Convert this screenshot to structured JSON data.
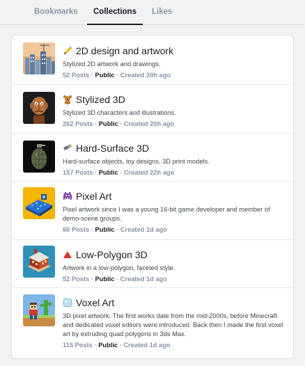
{
  "tabs": [
    {
      "label": "Bookmarks",
      "active": false
    },
    {
      "label": "Collections",
      "active": true
    },
    {
      "label": "Likes",
      "active": false
    }
  ],
  "collections": [
    {
      "icon": "pencil-icon",
      "title": "2D design and artwork",
      "description": "Stylized 2D artwork and drawings.",
      "posts": "52 Posts",
      "visibility": "Public",
      "created": "Created 20h ago"
    },
    {
      "icon": "teddy-bear-icon",
      "title": "Stylized 3D",
      "description": "Stylized 3D characters and illustrations.",
      "posts": "262 Posts",
      "visibility": "Public",
      "created": "Created 20h ago"
    },
    {
      "icon": "flashlight-icon",
      "title": "Hard-Surface 3D",
      "description": "Hard-surface objects, toy designs, 3D print models.",
      "posts": "157 Posts",
      "visibility": "Public",
      "created": "Created 22h ago"
    },
    {
      "icon": "space-invader-icon",
      "title": "Pixel Art",
      "description": "Pixel artwork since I was a young 16-bit game developer and member of demo-scene groups.",
      "posts": "60 Posts",
      "visibility": "Public",
      "created": "Created 1d ago"
    },
    {
      "icon": "red-triangle-icon",
      "title": "Low-Polygon 3D",
      "description": "Artwork in a low-polygon, faceted style.",
      "posts": "52 Posts",
      "visibility": "Public",
      "created": "Created 1d ago"
    },
    {
      "icon": "ice-cube-icon",
      "title": "Voxel Art",
      "description": "3D pixel artwork. The first works date from the mid-2000s, before Minecraft and dedicated voxel editors were introduced. Back then I made the first voxel art by extruding quad polygons in 3ds Max.",
      "posts": "115 Posts",
      "visibility": "Public",
      "created": "Created 1d ago"
    }
  ],
  "separator": "·"
}
